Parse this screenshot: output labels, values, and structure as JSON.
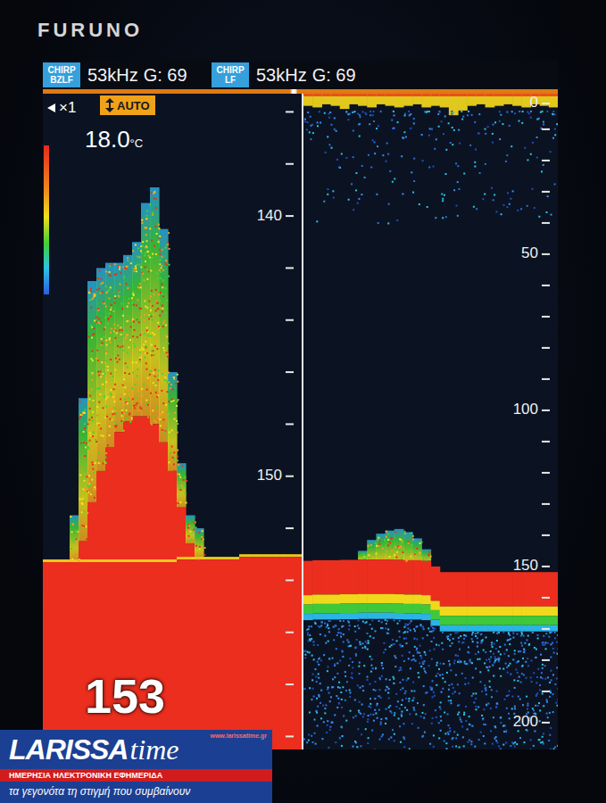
{
  "brand": "FURUNO",
  "channels": [
    {
      "badge": [
        "CHIRP",
        "BZLF"
      ],
      "frequency": "53kHz",
      "gain": "G: 69"
    },
    {
      "badge": [
        "CHIRP",
        "LF"
      ],
      "frequency": "53kHz",
      "gain": "G: 69"
    }
  ],
  "zoom_panel": {
    "zoom": "×1",
    "range_mode": "AUTO",
    "temperature": {
      "value": "18.0",
      "unit": "°C"
    },
    "depth_readout": "153",
    "axis": {
      "min": 135.3,
      "max": 160.5,
      "ticks": [
        {
          "label": "140",
          "value": 140
        },
        {
          "label": "150",
          "value": 150
        }
      ],
      "minor_ticks": [
        136,
        138,
        142,
        144,
        146,
        148,
        152,
        154,
        156,
        158,
        160
      ]
    },
    "echo": {
      "bottom": [
        153.3,
        153.3,
        153.3,
        153.3,
        153.3,
        153.3,
        153.3,
        153.3,
        153.3,
        153.3,
        153.3,
        153.3,
        153.3,
        153.3,
        153.3,
        153.2,
        153.2,
        153.2,
        153.2,
        153.2,
        153.2,
        153.2,
        153.1,
        153.1,
        153.1,
        153.1,
        153.1,
        153.1,
        153.1
      ],
      "school_core": [
        null,
        null,
        null,
        null,
        152.5,
        151.0,
        149.8,
        148.9,
        148.3,
        147.9,
        147.7,
        147.7,
        148.0,
        148.7,
        149.8,
        151.2,
        152.6,
        null,
        null,
        null,
        null,
        null,
        null,
        null,
        null,
        null,
        null,
        null,
        null
      ],
      "school_top": [
        null,
        null,
        null,
        151.5,
        147.0,
        142.5,
        142.0,
        141.8,
        141.8,
        141.5,
        141.0,
        139.5,
        138.9,
        140.5,
        146.0,
        149.5,
        151.5,
        152.0,
        null,
        null,
        null,
        null,
        null,
        null,
        null,
        null,
        null,
        null,
        null
      ]
    }
  },
  "main_panel": {
    "axis": {
      "min": -1.4,
      "max": 208.6,
      "ticks": [
        {
          "label": "0",
          "value": 0
        },
        {
          "label": "50",
          "value": 50
        },
        {
          "label": "100",
          "value": 100
        },
        {
          "label": "150",
          "value": 150
        },
        {
          "label": "200",
          "value": 200
        }
      ],
      "minor_ticks": [
        10,
        20,
        30,
        40,
        60,
        70,
        80,
        90,
        110,
        120,
        130,
        140,
        160,
        170,
        180,
        190
      ]
    },
    "echo": {
      "bottom": [
        148.2,
        148.0,
        148.0,
        148.0,
        147.9,
        147.9,
        147.8,
        147.8,
        147.8,
        147.8,
        147.9,
        148.0,
        148.0,
        148.2,
        150.0,
        151.8,
        151.8,
        151.8,
        151.8,
        151.8,
        151.8,
        151.8,
        151.8,
        151.8,
        151.8,
        151.8,
        151.8,
        151.8
      ],
      "fish_top": [
        null,
        null,
        null,
        null,
        null,
        null,
        145.0,
        141.5,
        139.5,
        138.5,
        138.0,
        139.0,
        141.0,
        144.5,
        null,
        null,
        null,
        null,
        null,
        null,
        null,
        null,
        null,
        null,
        null,
        null,
        null,
        null
      ],
      "surface": [
        2.5,
        3.0,
        2.0,
        2.5,
        3.5,
        2.0,
        2.5,
        3.0,
        2.0,
        2.5,
        3.0,
        2.5,
        2.0,
        3.0,
        2.5,
        3.0,
        5.5,
        4.0,
        2.5,
        2.0,
        3.0,
        2.5,
        2.0,
        2.5,
        3.0,
        2.0,
        2.5,
        3.0
      ]
    }
  },
  "watermark": {
    "name": "LARISSA",
    "name_accent": "time",
    "url": "www.larissatime.gr",
    "subtitle": "ΗΜΕΡΗΣΙΑ ΗΛΕΚΤΡΟΝΙΚΗ ΕΦΗΜΕΡΙΔΑ",
    "tagline": "τα γεγονότα τη στιγμή που συμβαίνουν"
  }
}
